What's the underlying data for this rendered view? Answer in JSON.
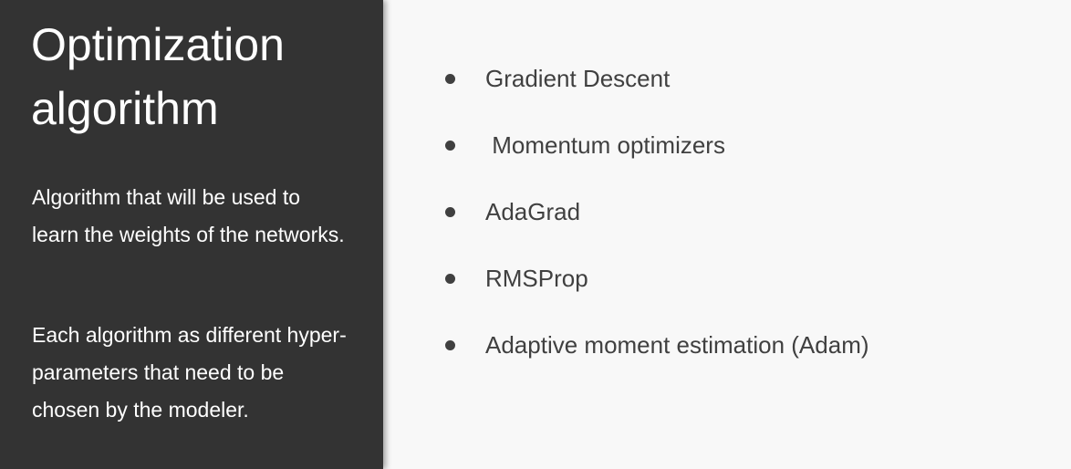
{
  "slide": {
    "title": "Optimization algorithm",
    "description": [
      "Algorithm that will be used to learn the weights of the networks.",
      "Each algorithm as different hyper-parameters that need to be chosen by the modeler."
    ],
    "bullets": [
      "Gradient Descent",
      " Momentum optimizers",
      "AdaGrad",
      "RMSProp",
      "Adaptive moment estimation (Adam)"
    ]
  },
  "colors": {
    "left_panel_bg": "#333333",
    "right_panel_bg": "#f8f8f8",
    "title_text": "#ffffff",
    "bullet_text": "#404040"
  }
}
